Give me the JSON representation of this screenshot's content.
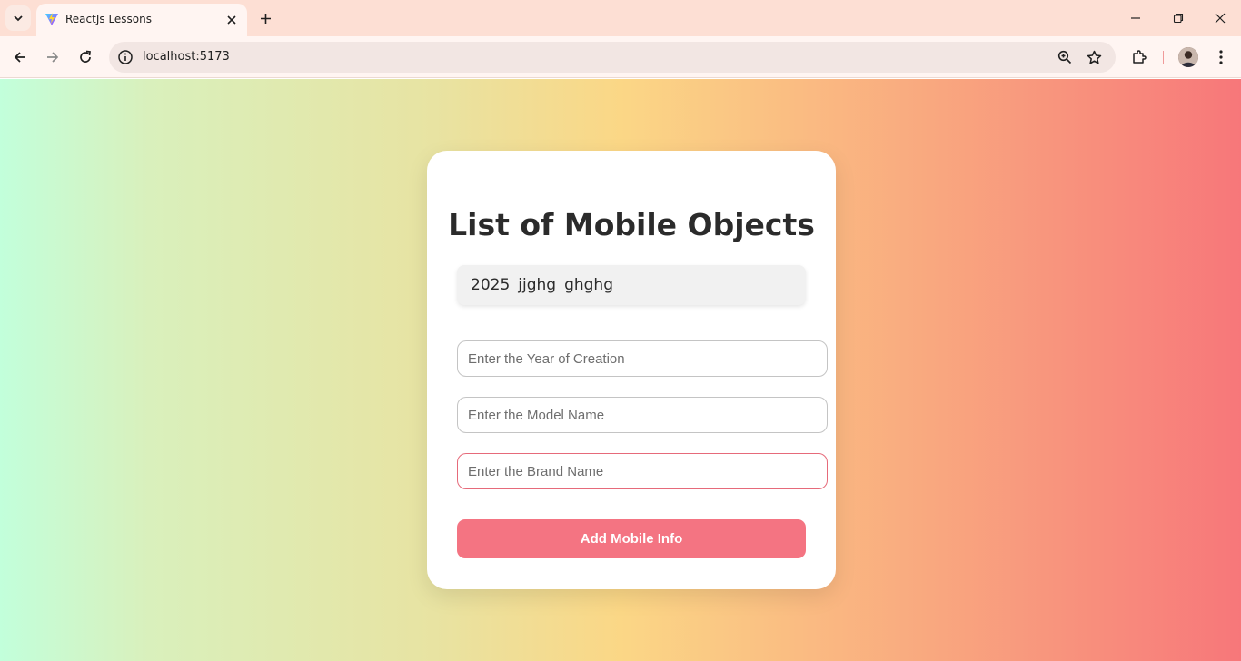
{
  "browser": {
    "tab_title": "ReactJs Lessons",
    "url": "localhost:5173"
  },
  "page": {
    "title": "List of Mobile Objects",
    "mobiles": [
      {
        "year": "2025",
        "model": "jjghg",
        "brand": "ghghg"
      }
    ],
    "form": {
      "year_placeholder": "Enter the Year of Creation",
      "model_placeholder": "Enter the Model Name",
      "brand_placeholder": "Enter the Brand Name",
      "submit_label": "Add Mobile Info"
    }
  },
  "colors": {
    "accent": "#f47482",
    "gradient": [
      "#c2ffdb",
      "#fbd786",
      "#f7777a"
    ]
  }
}
